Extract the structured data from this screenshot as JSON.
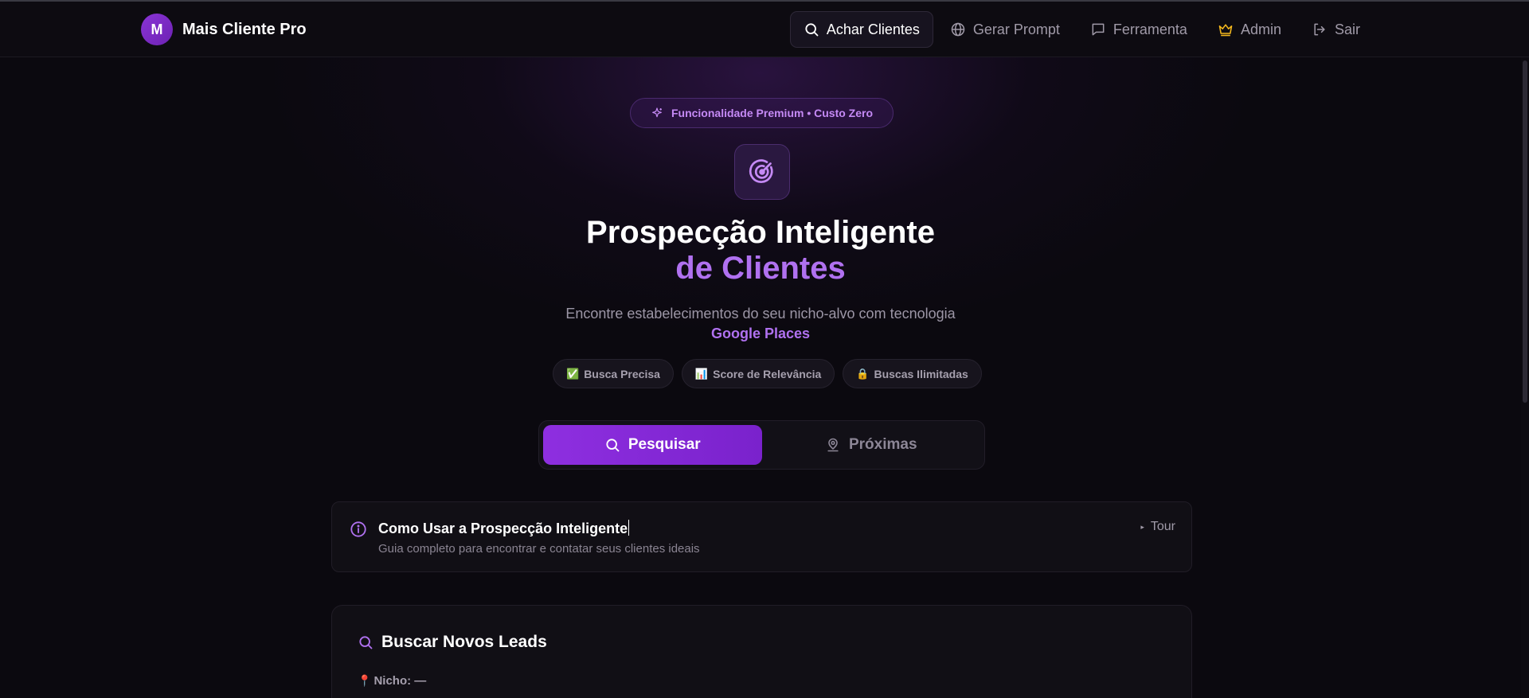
{
  "brand": {
    "logo_letter": "M",
    "name": "Mais Cliente Pro"
  },
  "nav": {
    "items": [
      {
        "label": "Achar Clientes",
        "icon": "search-icon",
        "active": true
      },
      {
        "label": "Gerar Prompt",
        "icon": "globe-icon",
        "active": false
      },
      {
        "label": "Ferramenta",
        "icon": "message-square-icon",
        "active": false
      },
      {
        "label": "Admin",
        "icon": "crown-icon",
        "active": false
      },
      {
        "label": "Sair",
        "icon": "logout-icon",
        "active": false
      }
    ]
  },
  "hero": {
    "badge": "Funcionalidade Premium • Custo Zero",
    "badge_icon": "sparkles-icon",
    "hero_icon": "radar-icon",
    "title_line1": "Prospecção Inteligente",
    "title_line2": "de Clientes",
    "subtitle_line1": "Encontre estabelecimentos do seu nicho-alvo com tecnologia",
    "subtitle_line2": "Google Places",
    "pills": [
      {
        "emoji": "✅",
        "label": "Busca Precisa"
      },
      {
        "emoji": "📊",
        "label": "Score de Relevância"
      },
      {
        "emoji": "🔒",
        "label": "Buscas Ilimitadas"
      }
    ]
  },
  "tabs": [
    {
      "label": "Pesquisar",
      "icon": "search-icon",
      "active": true
    },
    {
      "label": "Próximas",
      "icon": "map-pin-user-icon",
      "active": false
    }
  ],
  "help": {
    "icon": "info-icon",
    "title": "Como Usar a Prospecção Inteligente",
    "description": "Guia completo para encontrar e contatar seus clientes ideais",
    "tour_label": "Tour",
    "tour_icon": "▸"
  },
  "search": {
    "title": "Buscar Novos Leads",
    "niche_icon": "📍",
    "niche_label": "Nicho: —"
  },
  "colors": {
    "accent": "#8e2fe0",
    "accent_text": "#b071f0",
    "background": "#0b090f",
    "admin_crown": "#f4b81d"
  }
}
